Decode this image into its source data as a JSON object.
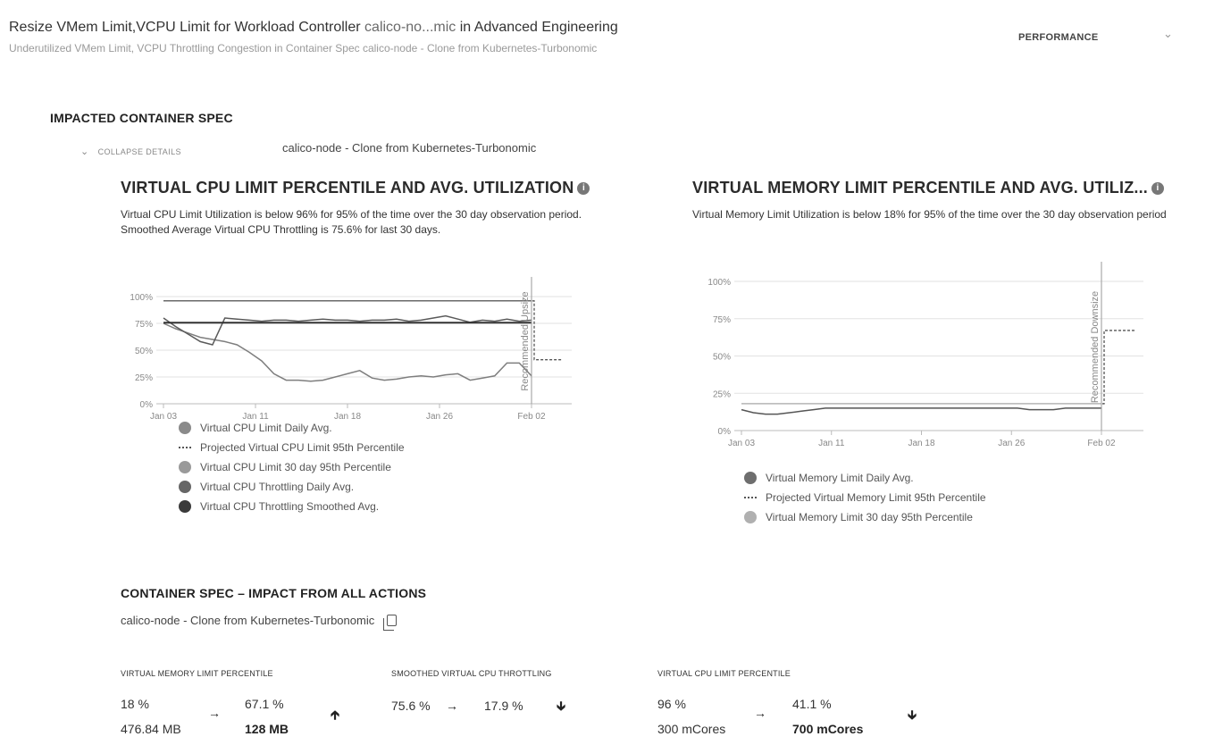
{
  "header": {
    "title_prefix": "Resize VMem Limit,VCPU Limit for Workload Controller",
    "title_entity": "calico-no...mic",
    "title_suffix": "in Advanced Engineering",
    "subtitle": "Underutilized VMem Limit, VCPU Throttling Congestion in Container Spec calico-node - Clone from Kubernetes-Turbonomic",
    "category": "PERFORMANCE"
  },
  "impacted": {
    "heading": "IMPACTED CONTAINER SPEC",
    "collapse_label": "COLLAPSE DETAILS",
    "spec_name": "calico-node - Clone from Kubernetes-Turbonomic"
  },
  "cpu_chart": {
    "title": "VIRTUAL CPU LIMIT PERCENTILE AND AVG. UTILIZATION",
    "description": "Virtual CPU Limit Utilization is below 96% for 95% of the time over the 30 day observation period. Smoothed Average Virtual CPU Throttling is 75.6% for last 30 days.",
    "marker_label": "Recommended Upsize",
    "legend": [
      {
        "label": "Virtual CPU Limit Daily Avg.",
        "color": "#8a8a8a",
        "style": "dot"
      },
      {
        "label": "Projected Virtual CPU Limit 95th Percentile",
        "color": "#555555",
        "style": "dash"
      },
      {
        "label": "Virtual CPU Limit 30 day 95th Percentile",
        "color": "#9a9a9a",
        "style": "dot"
      },
      {
        "label": "Virtual CPU Throttling Daily Avg.",
        "color": "#666666",
        "style": "dot"
      },
      {
        "label": "Virtual CPU Throttling Smoothed Avg.",
        "color": "#3a3a3a",
        "style": "dot"
      }
    ]
  },
  "mem_chart": {
    "title": "VIRTUAL MEMORY LIMIT PERCENTILE AND AVG. UTILIZ...",
    "description": "Virtual Memory Limit Utilization is below 18% for 95% of the time over the 30 day observation period",
    "marker_label": "Recommended Downsize",
    "legend": [
      {
        "label": "Virtual Memory Limit Daily Avg.",
        "color": "#6e6e6e",
        "style": "dot"
      },
      {
        "label": "Projected Virtual Memory Limit 95th Percentile",
        "color": "#555555",
        "style": "dash"
      },
      {
        "label": "Virtual Memory Limit 30 day 95th Percentile",
        "color": "#b0b0b0",
        "style": "dot"
      }
    ]
  },
  "chart_data": [
    {
      "type": "line",
      "xlabel": "",
      "ylabel": "",
      "xticks": [
        "Jan 03",
        "Jan 11",
        "Jan 18",
        "Jan 26",
        "Feb 02"
      ],
      "yticks": [
        "100%",
        "75%",
        "50%",
        "25%",
        "0%"
      ],
      "ylim": [
        0,
        100
      ],
      "x": [
        0,
        1,
        2,
        3,
        4,
        5,
        6,
        7,
        8,
        9,
        10,
        11,
        12,
        13,
        14,
        15,
        16,
        17,
        18,
        19,
        20,
        21,
        22,
        23,
        24,
        25,
        26,
        27,
        28,
        29,
        30
      ],
      "series": [
        {
          "name": "Virtual CPU Limit Daily Avg.",
          "values": [
            75,
            70,
            66,
            62,
            60,
            58,
            55,
            48,
            40,
            28,
            22,
            22,
            21,
            22,
            25,
            28,
            31,
            24,
            22,
            23,
            25,
            26,
            25,
            27,
            28,
            22,
            24,
            26,
            38,
            38,
            26
          ]
        },
        {
          "name": "Virtual CPU Throttling Daily Avg.",
          "values": [
            80,
            72,
            65,
            58,
            55,
            80,
            79,
            78,
            77,
            78,
            78,
            77,
            78,
            79,
            78,
            78,
            77,
            78,
            78,
            79,
            77,
            78,
            80,
            82,
            79,
            76,
            78,
            77,
            79,
            77,
            78
          ]
        },
        {
          "name": "Virtual CPU Throttling Smoothed Avg.",
          "values": [
            75.6,
            75.6,
            75.6,
            75.6,
            75.6,
            75.6,
            75.6,
            75.6,
            75.6,
            75.6,
            75.6,
            75.6,
            75.6,
            75.6,
            75.6,
            75.6,
            75.6,
            75.6,
            75.6,
            75.6,
            75.6,
            75.6,
            75.6,
            75.6,
            75.6,
            75.6,
            75.6,
            75.6,
            75.6,
            75.6,
            75.6
          ]
        },
        {
          "name": "Virtual CPU Limit 30 day 95th Percentile",
          "values": [
            96,
            96,
            96,
            96,
            96,
            96,
            96,
            96,
            96,
            96,
            96,
            96,
            96,
            96,
            96,
            96,
            96,
            96,
            96,
            96,
            96,
            96,
            96,
            96,
            96,
            96,
            96,
            96,
            96,
            96,
            96
          ]
        }
      ],
      "projected": {
        "name": "Projected Virtual CPU Limit 95th Percentile",
        "value": 41.1
      }
    },
    {
      "type": "line",
      "xlabel": "",
      "ylabel": "",
      "xticks": [
        "Jan 03",
        "Jan 11",
        "Jan 18",
        "Jan 26",
        "Feb 02"
      ],
      "yticks": [
        "100%",
        "75%",
        "50%",
        "25%",
        "0%"
      ],
      "ylim": [
        0,
        100
      ],
      "x": [
        0,
        1,
        2,
        3,
        4,
        5,
        6,
        7,
        8,
        9,
        10,
        11,
        12,
        13,
        14,
        15,
        16,
        17,
        18,
        19,
        20,
        21,
        22,
        23,
        24,
        25,
        26,
        27,
        28,
        29,
        30
      ],
      "series": [
        {
          "name": "Virtual Memory Limit Daily Avg.",
          "values": [
            14,
            12,
            11,
            11,
            12,
            13,
            14,
            15,
            15,
            15,
            15,
            15,
            15,
            15,
            15,
            15,
            15,
            15,
            15,
            15,
            15,
            15,
            15,
            15,
            14,
            14,
            14,
            15,
            15,
            15,
            15
          ]
        },
        {
          "name": "Virtual Memory Limit 30 day 95th Percentile",
          "values": [
            18,
            18,
            18,
            18,
            18,
            18,
            18,
            18,
            18,
            18,
            18,
            18,
            18,
            18,
            18,
            18,
            18,
            18,
            18,
            18,
            18,
            18,
            18,
            18,
            18,
            18,
            18,
            18,
            18,
            18,
            18
          ]
        }
      ],
      "projected": {
        "name": "Projected Virtual Memory Limit 95th Percentile",
        "value": 67.1
      }
    }
  ],
  "impact": {
    "heading": "CONTAINER SPEC – IMPACT FROM ALL ACTIONS",
    "spec_name": "calico-node - Clone from Kubernetes-Turbonomic",
    "metrics": [
      {
        "label": "VIRTUAL MEMORY LIMIT PERCENTILE",
        "from_pct": "18 %",
        "from_abs": "476.84 MB",
        "to_pct": "67.1 %",
        "to_abs": "128 MB",
        "direction": "up"
      },
      {
        "label": "SMOOTHED VIRTUAL CPU THROTTLING",
        "from_pct": "75.6 %",
        "to_pct": "17.9 %",
        "direction": "down"
      },
      {
        "label": "VIRTUAL CPU LIMIT PERCENTILE",
        "from_pct": "96 %",
        "from_abs": "300 mCores",
        "to_pct": "41.1 %",
        "to_abs": "700 mCores",
        "direction": "down"
      }
    ]
  }
}
